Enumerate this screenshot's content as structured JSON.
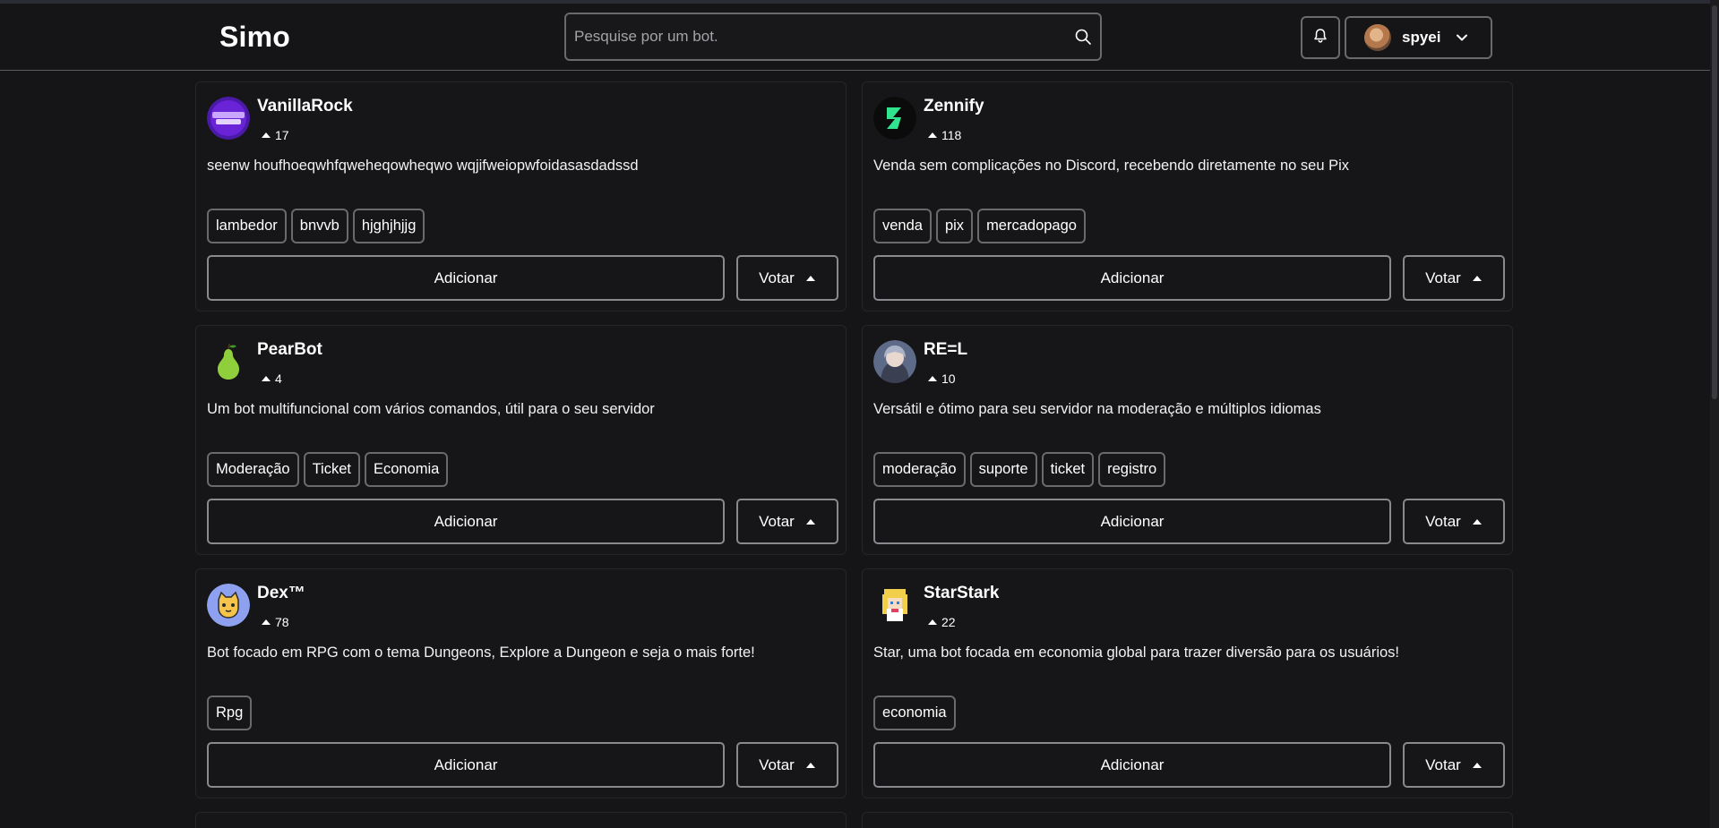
{
  "app": {
    "logo": "Simo"
  },
  "search": {
    "placeholder": "Pesquise por um bot."
  },
  "user": {
    "name": "spyei"
  },
  "buttons": {
    "add": "Adicionar",
    "vote": "Votar"
  },
  "bots": [
    {
      "name": "VanillaRock",
      "votes": "17",
      "description": "seenw houfhoeqwhfqweheqowheqwo wqjifweiopwfoidasasdadssd",
      "tags": [
        "lambedor",
        "bnvvb",
        "hjghjhjjg"
      ],
      "avatar": "vanillarock-logo"
    },
    {
      "name": "Zennify",
      "votes": "118",
      "description": "Venda sem complicações no Discord, recebendo diretamente no seu Pix",
      "tags": [
        "venda",
        "pix",
        "mercadopago"
      ],
      "avatar": "zennify-logo"
    },
    {
      "name": "PearBot",
      "votes": "4",
      "description": "Um bot multifuncional com vários comandos, útil para o seu servidor",
      "tags": [
        "Moderação",
        "Ticket",
        "Economia"
      ],
      "avatar": "pear-icon"
    },
    {
      "name": "RE=L",
      "votes": "10",
      "description": "Versátil e ótimo para seu servidor na moderação e múltiplos idiomas",
      "tags": [
        "moderação",
        "suporte",
        "ticket",
        "registro"
      ],
      "avatar": "anime-girl-avatar"
    },
    {
      "name": "Dex™",
      "votes": "78",
      "description": "Bot focado em RPG com o tema Dungeons, Explore a Dungeon e seja o mais forte!",
      "tags": [
        "Rpg"
      ],
      "avatar": "cat-avatar"
    },
    {
      "name": "StarStark",
      "votes": "22",
      "description": "Star, uma bot focada em economia global para trazer diversão para os usuários!",
      "tags": [
        "economia"
      ],
      "avatar": "pixel-girl-avatar"
    }
  ],
  "colors": {
    "background": "#151517",
    "card": "#161618",
    "border": "#6a6a6e",
    "text": "#ffffff"
  }
}
